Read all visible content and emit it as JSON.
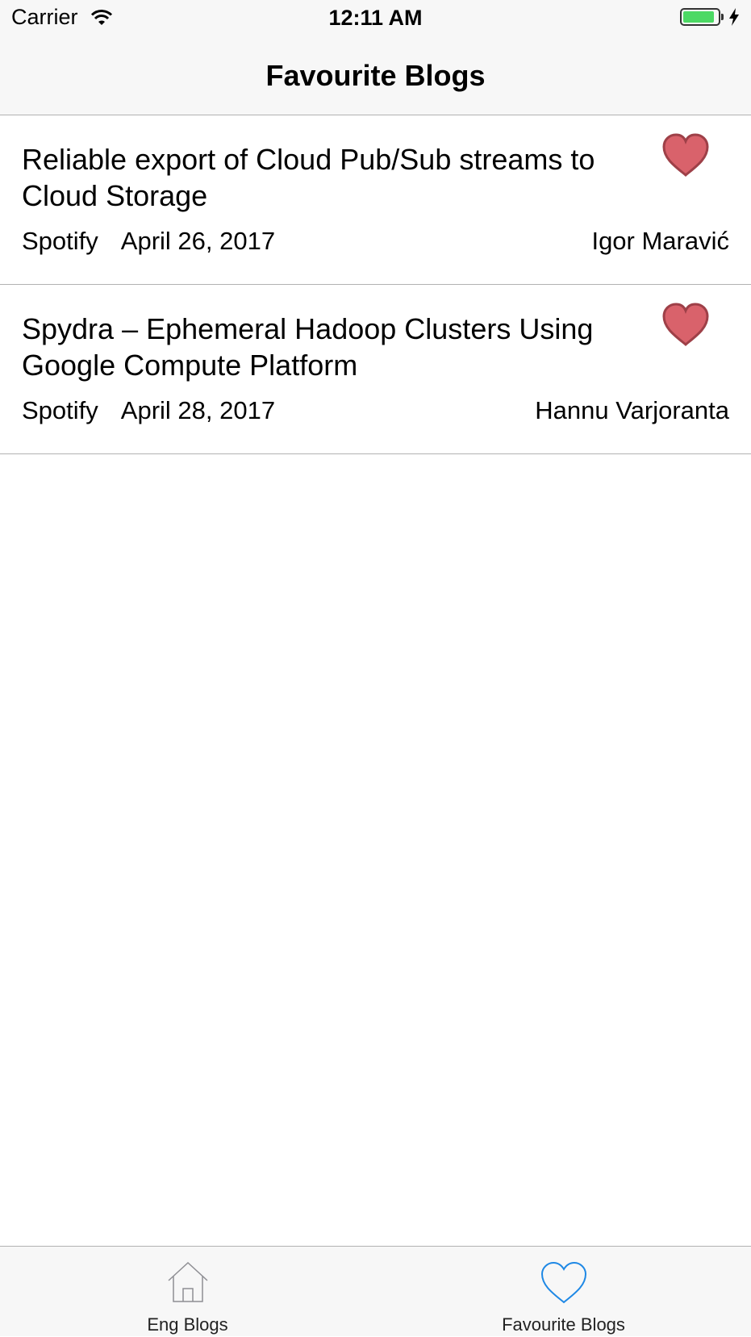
{
  "status_bar": {
    "carrier": "Carrier",
    "time": "12:11 AM",
    "battery_level": 0.9,
    "charging": true
  },
  "nav": {
    "title": "Favourite Blogs"
  },
  "blogs": [
    {
      "title": "Reliable export of Cloud Pub/Sub streams to Cloud Storage",
      "source": "Spotify",
      "date": "April 26, 2017",
      "author": "Igor Maravić",
      "favourite": true
    },
    {
      "title": "Spydra – Ephemeral Hadoop Clusters Using Google Compute Platform",
      "source": "Spotify",
      "date": "April 28, 2017",
      "author": "Hannu Varjoranta",
      "favourite": true
    }
  ],
  "tab_bar": {
    "tabs": [
      {
        "label": "Eng Blogs",
        "icon": "house-icon",
        "selected": false
      },
      {
        "label": "Favourite Blogs",
        "icon": "heart-outline-icon",
        "selected": true
      }
    ]
  },
  "colors": {
    "heart_fill": "#d9626b",
    "heart_stroke": "#9e4048",
    "tab_selected": "#1e88e5",
    "tab_unselected": "#8e8e93",
    "battery_fill": "#4cd964"
  }
}
